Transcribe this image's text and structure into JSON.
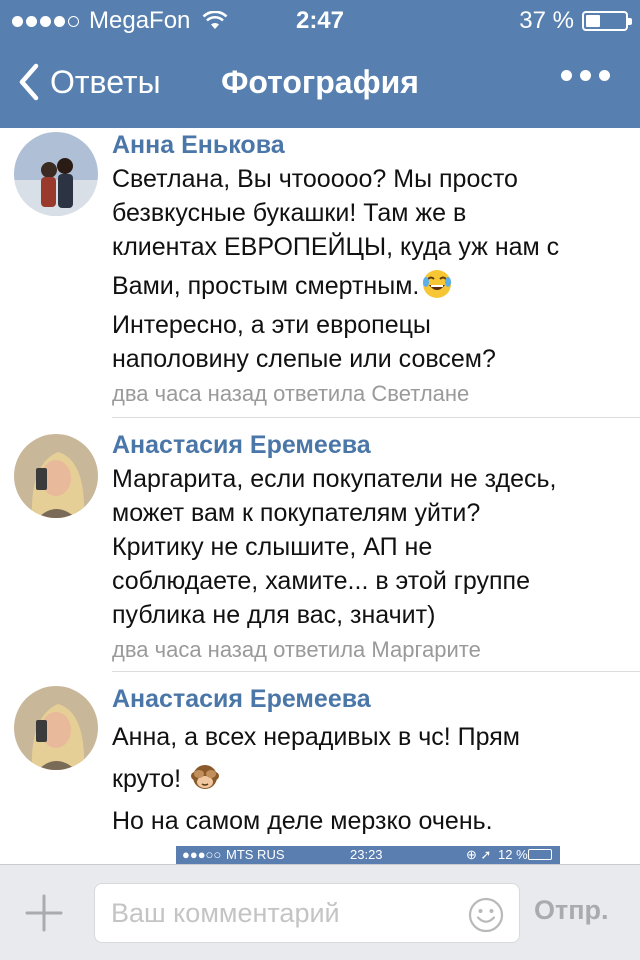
{
  "status_bar": {
    "carrier": "MegaFon",
    "time": "2:47",
    "battery_text": "37 %",
    "battery_level": 0.37
  },
  "nav": {
    "back_label": "Ответы",
    "title": "Фотография"
  },
  "comments": [
    {
      "author": "Анна Енькова",
      "lines": [
        "Светлана, Вы чтооооо? Мы просто",
        "безвкусные букашки! Там же в",
        "клиентах ЕВРОПЕЙЦЫ, куда уж нам с",
        "Вами, простым смертным.",
        "Интересно, а эти европецы",
        "наполовину слепые или совсем?"
      ],
      "meta": "два часа назад ответила Светлане"
    },
    {
      "author": "Анастасия Еремеева",
      "lines": [
        "Маргарита, если покупатели не здесь,",
        "может вам к покупателям уйти?",
        "Критику не слышите, АП не",
        "соблюдаете, хамите... в этой группе",
        "публика не для вас, значит)"
      ],
      "meta": "два часа назад ответила Маргарите"
    },
    {
      "author": "Анастасия Еремеева",
      "lines": [
        "Анна, а всех нерадивых в чс! Прям",
        "круто!",
        "Но на самом деле мерзко очень."
      ]
    }
  ],
  "embedded_screenshot": {
    "carrier": "MTS RUS",
    "time": "23:23",
    "battery": "12 %"
  },
  "composer": {
    "placeholder": "Ваш комментарий",
    "send_label": "Отпр."
  }
}
